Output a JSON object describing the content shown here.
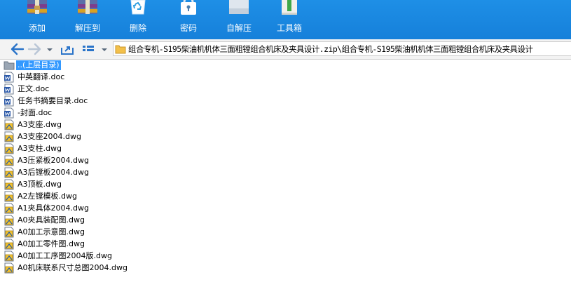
{
  "toolbar": {
    "items": [
      {
        "label": "添加",
        "icon": "add-archive-icon"
      },
      {
        "label": "解压到",
        "icon": "extract-to-icon"
      },
      {
        "label": "删除",
        "icon": "recycle-bin-icon"
      },
      {
        "label": "密码",
        "icon": "lock-icon"
      },
      {
        "label": "自解压",
        "icon": "self-extract-icon"
      },
      {
        "label": "工具箱",
        "icon": "toolbox-icon"
      }
    ]
  },
  "address": {
    "path": "组合专机-S195柴油机机体三面粗镗组合机床及夹具设计.zip\\组合专机-S195柴油机机体三面粗镗组合机床及夹具设计"
  },
  "files": [
    {
      "name": "..(上层目录)",
      "type": "parent",
      "selected": true
    },
    {
      "name": "中英翻译.doc",
      "type": "doc"
    },
    {
      "name": "正文.doc",
      "type": "doc"
    },
    {
      "name": "任务书摘要目录.doc",
      "type": "doc"
    },
    {
      "name": "-封面.doc",
      "type": "doc"
    },
    {
      "name": "A3支座.dwg",
      "type": "dwg"
    },
    {
      "name": "A3支座2004.dwg",
      "type": "dwg"
    },
    {
      "name": "A3支柱.dwg",
      "type": "dwg"
    },
    {
      "name": "A3压紧板2004.dwg",
      "type": "dwg"
    },
    {
      "name": "A3后镗板2004.dwg",
      "type": "dwg"
    },
    {
      "name": "A3顶板.dwg",
      "type": "dwg"
    },
    {
      "name": "A2左镗模板.dwg",
      "type": "dwg"
    },
    {
      "name": "A1夹具体2004.dwg",
      "type": "dwg"
    },
    {
      "name": "A0夹具装配图.dwg",
      "type": "dwg"
    },
    {
      "name": "A0加工示意图.dwg",
      "type": "dwg"
    },
    {
      "name": "A0加工零件图.dwg",
      "type": "dwg"
    },
    {
      "name": "A0加工工序图2004版.dwg",
      "type": "dwg"
    },
    {
      "name": "A0机床联系尺寸总图2004.dwg",
      "type": "dwg"
    }
  ],
  "colors": {
    "toolbar_bg": "#1a87e0",
    "selection": "#3399ff",
    "nav_arrow": "#2a74c9"
  }
}
